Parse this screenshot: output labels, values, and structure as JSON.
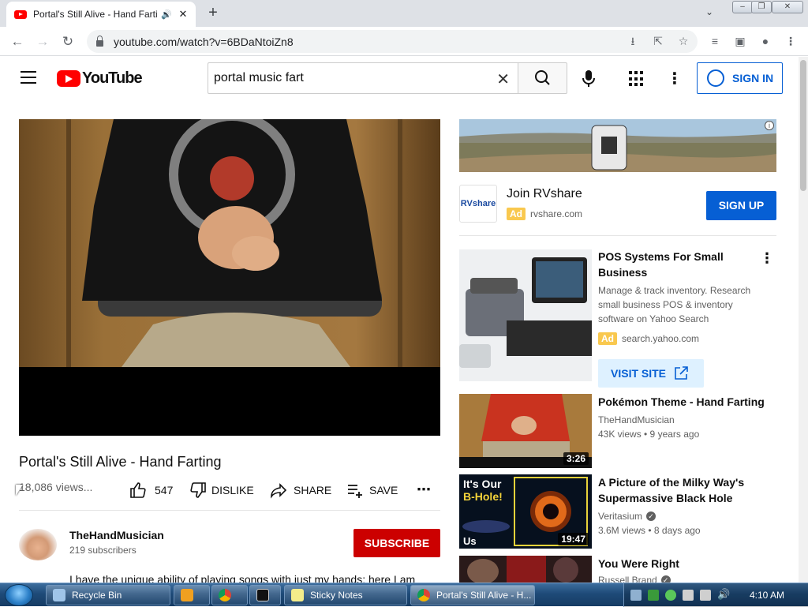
{
  "browser": {
    "tab_title": "Portal's Still Alive - Hand Farting",
    "new_tab_label": "+",
    "url": "youtube.com/watch?v=6BDaNtoiZn8"
  },
  "header": {
    "logo_text": "YouTube",
    "search_value": "portal music fart",
    "sign_in_label": "SIGN IN"
  },
  "video": {
    "title": "Portal's Still Alive - Hand Farting",
    "views": "18,086 views...",
    "likes": "547",
    "dislike_label": "DISLIKE",
    "share_label": "SHARE",
    "save_label": "SAVE",
    "channel_name": "TheHandMusician",
    "subscribers": "219 subscribers",
    "subscribe_label": "SUBSCRIBE",
    "description": "I have the unique ability of playing songs with just my hands; here I am"
  },
  "ad_top": {
    "logo_text": "RVshare",
    "title": "Join RVshare",
    "badge": "Ad",
    "url": "rvshare.com",
    "cta": "SIGN UP",
    "info": "i"
  },
  "ad_pos": {
    "title": "POS Systems For Small Business",
    "description": "Manage & track inventory. Research small business POS & inventory software on Yahoo Search",
    "badge": "Ad",
    "url": "search.yahoo.com",
    "cta": "VISIT SITE"
  },
  "related": [
    {
      "title": "Pokémon Theme - Hand Farting",
      "channel": "TheHandMusician",
      "meta": "43K views • 9 years ago",
      "duration": "3:26"
    },
    {
      "title": "A Picture of the Milky Way's Supermassive Black Hole",
      "channel": "Veritasium",
      "meta": "3.6M views • 8 days ago",
      "duration": "19:47",
      "thumb_text_1": "It's Our",
      "thumb_text_2": "B-Hole!",
      "thumb_text_3": "Us"
    },
    {
      "title": "You Were Right",
      "channel": "Russell Brand",
      "meta": ""
    }
  ],
  "taskbar": {
    "items": [
      {
        "label": "Recycle Bin"
      },
      {
        "label": ""
      },
      {
        "label": ""
      },
      {
        "label": ""
      },
      {
        "label": "Sticky Notes"
      },
      {
        "label": "Portal's Still Alive - H..."
      }
    ],
    "clock": "4:10 AM"
  },
  "colors": {
    "youtube_red": "#ff0000",
    "subscribe_red": "#cc0000",
    "link_blue": "#065fd4",
    "ad_badge": "#f9c84e"
  }
}
